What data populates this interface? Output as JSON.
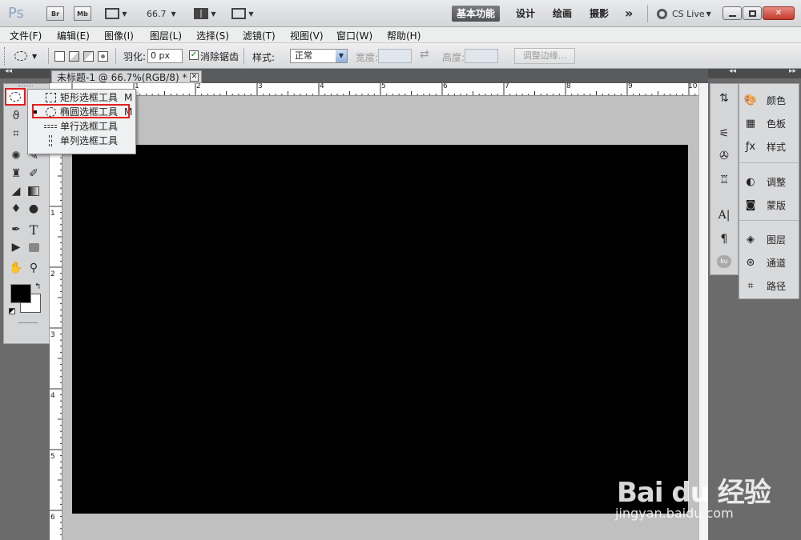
{
  "appbar": {
    "logo": "Ps",
    "br_label": "Br",
    "mb_label": "Mb",
    "zoom": "66.7",
    "workspaces": [
      "基本功能",
      "设计",
      "绘画",
      "摄影"
    ],
    "more": "»",
    "cslive": "CS Live"
  },
  "menu": [
    "文件(F)",
    "编辑(E)",
    "图像(I)",
    "图层(L)",
    "选择(S)",
    "滤镜(T)",
    "视图(V)",
    "窗口(W)",
    "帮助(H)"
  ],
  "options": {
    "feather_label": "羽化:",
    "feather_value": "0 px",
    "antialias_label": "消除锯齿",
    "style_label": "样式:",
    "style_value": "正常",
    "width_label": "宽度:",
    "height_label": "高度:",
    "refine_label": "调整边缘..."
  },
  "document": {
    "tab_title": "未标题-1 @ 66.7%(RGB/8) *",
    "ruler_top": [
      "1",
      "2",
      "3",
      "4",
      "5",
      "6",
      "7",
      "8",
      "9",
      "10"
    ],
    "ruler_left": [
      "1",
      "2",
      "3",
      "4",
      "5",
      "6"
    ]
  },
  "flyout": {
    "items": [
      {
        "label": "矩形选框工具",
        "key": "M"
      },
      {
        "label": "椭圆选框工具",
        "key": "M"
      },
      {
        "label": "单行选框工具",
        "key": ""
      },
      {
        "label": "单列选框工具",
        "key": ""
      }
    ]
  },
  "panels": {
    "items": [
      "颜色",
      "色板",
      "样式",
      "调整",
      "蒙版",
      "图层",
      "通道",
      "路径"
    ]
  },
  "watermark": {
    "logo": "Bai du 经验",
    "url": "jingyan.baidu.com"
  }
}
